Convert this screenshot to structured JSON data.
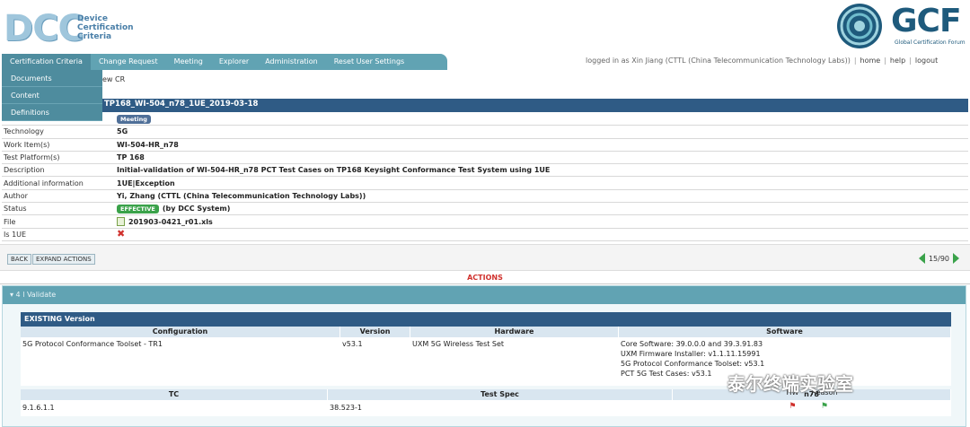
{
  "header": {
    "logo_text": "DCC",
    "logo_sub": [
      "Device",
      "Certification",
      "Criteria"
    ],
    "gcf_text": "GCF",
    "gcf_sub": "Global Certification Forum"
  },
  "nav": {
    "items": [
      "Certification Criteria",
      "Change Request",
      "Meeting",
      "Explorer",
      "Administration",
      "Reset User Settings"
    ]
  },
  "user": {
    "logged_in": "logged in as Xin Jiang (CTTL (China Telecommunication Technology Labs))",
    "links": [
      "home",
      "help",
      "logout"
    ]
  },
  "dropdown": {
    "items": [
      "Documents",
      "Content",
      "Definitions"
    ]
  },
  "crumb": "ew CR",
  "title": "TP168_WI-504_n78_1UE_2019-03-18",
  "details": {
    "rows": [
      {
        "label": "",
        "value": "Meeting",
        "type": "meeting"
      },
      {
        "label": "Technology",
        "value": "5G"
      },
      {
        "label": "Work Item(s)",
        "value": "WI-504-HR_n78"
      },
      {
        "label": "Test Platform(s)",
        "value": "TP 168"
      },
      {
        "label": "Description",
        "value": "Initial-validation of WI-504-HR_n78 PCT Test Cases on TP168 Keysight Conformance Test System using 1UE"
      },
      {
        "label": "Additional information",
        "value": "1UE|Exception"
      },
      {
        "label": "Author",
        "value": "Yi, Zhang (CTTL (China Telecommunication Technology Labs))"
      },
      {
        "label": "Status",
        "value": "EFFECTIVE",
        "extra": "(by DCC System)",
        "type": "status"
      },
      {
        "label": "File",
        "value": "201903-0421_r01.xls",
        "type": "file"
      },
      {
        "label": "Is 1UE",
        "value": "✖",
        "type": "x"
      }
    ]
  },
  "buttons": {
    "back": "BACK",
    "expand": "EXPAND ACTIONS"
  },
  "pager": "15/90",
  "actions_label": "ACTIONS",
  "panel_head": "▾ 4 l  Validate",
  "version": {
    "title": "EXISTING Version",
    "headers": [
      "Configuration",
      "Version",
      "Hardware",
      "Software"
    ],
    "row": {
      "configuration": "5G Protocol Conformance Toolset - TR1",
      "version": "v53.1",
      "hardware": "UXM 5G Wireless Test Set",
      "software": [
        "Core Software: 39.0.0.0 and 39.3.91.83",
        "UXM Firmware Installer: v1.1.11.15991",
        "5G Protocol Conformance Toolset: v53.1",
        "PCT 5G Test Cases: v53.1"
      ]
    }
  },
  "tc": {
    "headers": [
      "TC",
      "Test Spec",
      "n78"
    ],
    "row": {
      "tc": "9.1.6.1.1",
      "spec": "38.523-1",
      "flags": [
        "HW",
        "Reason"
      ]
    }
  },
  "watermark": "泰尔终端实验室",
  "colors": {
    "nav": "#61a3b3",
    "title": "#2f5b85",
    "effective": "#3aa24a",
    "error": "#d0312d"
  }
}
